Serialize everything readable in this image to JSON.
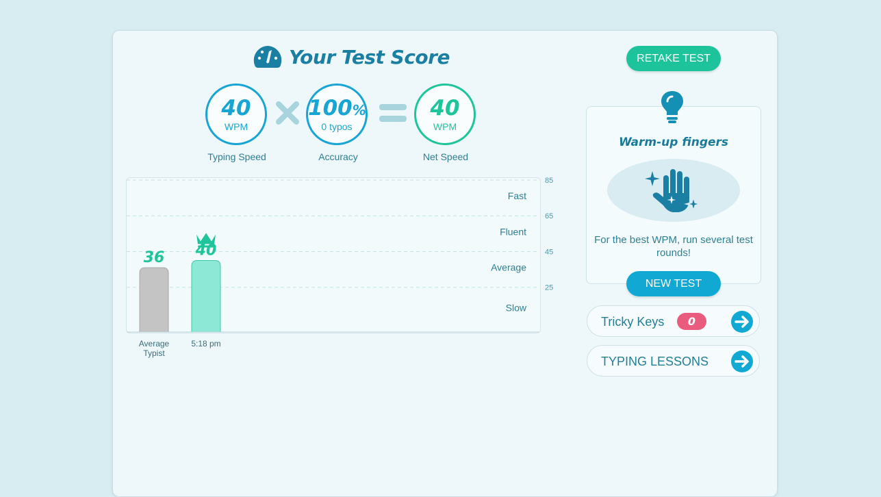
{
  "header": {
    "title": "Your Test Score"
  },
  "score": {
    "typing_speed": {
      "value": "40",
      "unit": "WPM",
      "caption": "Typing Speed"
    },
    "accuracy": {
      "value": "100",
      "unit_suffix": "%",
      "sub": "0 typos",
      "caption": "Accuracy"
    },
    "net_speed": {
      "value": "40",
      "unit": "WPM",
      "caption": "Net Speed"
    }
  },
  "chart_data": {
    "type": "bar",
    "categories": [
      "Average Typist",
      "5:18 pm"
    ],
    "category_lines": [
      [
        "Average",
        "Typist"
      ],
      [
        "5:18 pm"
      ]
    ],
    "values": [
      36,
      40
    ],
    "value_labels": [
      "36",
      "40"
    ],
    "y_ticks": [
      85,
      65,
      45,
      25
    ],
    "y_tick_labels": [
      "85",
      "65",
      "45",
      "25"
    ],
    "ylim": [
      0,
      85
    ],
    "bands": [
      {
        "label": "Fast",
        "range": [
          65,
          85
        ]
      },
      {
        "label": "Fluent",
        "range": [
          45,
          65
        ]
      },
      {
        "label": "Average",
        "range": [
          25,
          45
        ]
      },
      {
        "label": "Slow",
        "range": [
          0,
          25
        ]
      }
    ],
    "colors": [
      "#c4c4c4",
      "#8ee8d6"
    ],
    "highlight_index": 1,
    "grid": true
  },
  "actions": {
    "retake_label": "RETAKE TEST",
    "new_test_label": "NEW TEST"
  },
  "tip": {
    "title": "Warm-up fingers",
    "text": "For the best WPM, run several test rounds!"
  },
  "tricky_keys": {
    "label": "Tricky Keys",
    "count": "0"
  },
  "lessons": {
    "label": "TYPING LESSONS"
  },
  "colors": {
    "primary": "#19a5d4",
    "green": "#1ec59a",
    "title": "#1a7fa3",
    "badge": "#ea5c7d"
  }
}
